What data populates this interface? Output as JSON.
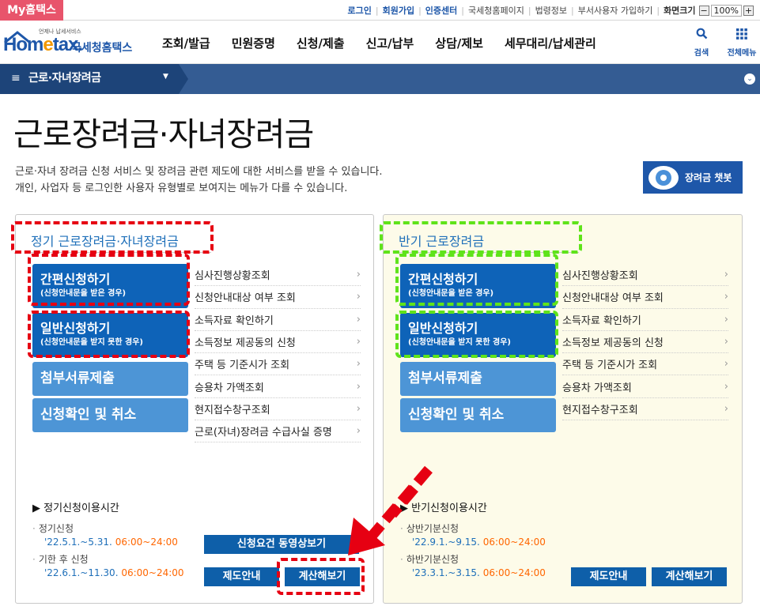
{
  "topbar": {
    "my_tab": "My홈택스",
    "links": [
      {
        "label": "로그인",
        "emphasis": true
      },
      {
        "label": "회원가입",
        "emphasis": true
      },
      {
        "label": "인증센터",
        "emphasis": true
      },
      {
        "label": "국세청홈페이지",
        "emphasis": false
      },
      {
        "label": "법령정보",
        "emphasis": false
      },
      {
        "label": "부서사용자 가입하기",
        "emphasis": false
      }
    ],
    "zoom_label": "화면크기",
    "zoom_minus": "−",
    "zoom_value": "100%",
    "zoom_plus": "+"
  },
  "header": {
    "logo_small": "언제나 납세서비스",
    "logo_text_a": "Hom",
    "logo_text_e": "e",
    "logo_text_b": "tax.",
    "logo_kr": "국세청홈택스",
    "gnb": [
      "조회/발급",
      "민원증명",
      "신청/제출",
      "신고/납부",
      "상담/제보",
      "세무대리/납세관리"
    ],
    "search_label": "검색",
    "search_icon": "search-icon",
    "all_menu_label": "전체메뉴",
    "all_menu_icon": "grid-icon"
  },
  "navbar": {
    "menu_icon": "≡",
    "title": "근로·자녀장려금",
    "caret": "▼",
    "expand": "⌄"
  },
  "page": {
    "title": "근로장려금·자녀장려금",
    "desc1": "근로·자녀 장려금 신청 서비스 및 장려금 관련 제도에 대한 서비스를 받을 수 있습니다.",
    "desc2": "개인, 사업자 등 로그인한 사용자 유형별로 보여지는 메뉴가 다를 수 있습니다.",
    "chatbot_label": "장려금 챗봇"
  },
  "left_panel": {
    "title": "정기 근로장려금·자녀장려금",
    "btn_easy": "간편신청하기",
    "btn_easy_sub": "(신청안내문을 받은 경우)",
    "btn_general": "일반신청하기",
    "btn_general_sub": "(신청안내문을 받지 못한 경우)",
    "btn_attach": "첨부서류제출",
    "btn_confirm": "신청확인 및 취소",
    "links": [
      "심사진행상황조회",
      "신청안내대상 여부 조회",
      "소득자료 확인하기",
      "소득정보 제공동의 신청",
      "주택 등 기준시가 조회",
      "승용차 가액조회",
      "현지접수창구조회",
      "근로(자녀)장려금 수급사실 증명"
    ],
    "time_title": "정기신청이용시간",
    "time_items": [
      {
        "label": "정기신청",
        "date": "'22.5.1.~5.31.",
        "time": "06:00~24:00"
      },
      {
        "label": "기한 후 신청",
        "date": "'22.6.1.~11.30.",
        "time": "06:00~24:00"
      }
    ],
    "btn_video": "신청요건 동영상보기",
    "btn_guide": "제도안내",
    "btn_calc": "계산해보기"
  },
  "right_panel": {
    "title": "반기 근로장려금",
    "btn_easy": "간편신청하기",
    "btn_easy_sub": "(신청안내문을 받은 경우)",
    "btn_general": "일반신청하기",
    "btn_general_sub": "(신청안내문을 받지 못한 경우)",
    "btn_attach": "첨부서류제출",
    "btn_confirm": "신청확인 및 취소",
    "links": [
      "심사진행상황조회",
      "신청안내대상 여부 조회",
      "소득자료 확인하기",
      "소득정보 제공동의 신청",
      "주택 등 기준시가 조회",
      "승용차 가액조회",
      "현지접수창구조회"
    ],
    "time_title": "반기신청이용시간",
    "time_items": [
      {
        "label": "상반기분신청",
        "date": "'22.9.1.~9.15.",
        "time": "06:00~24:00"
      },
      {
        "label": "하반기분신청",
        "date": "'23.3.1.~3.15.",
        "time": "06:00~24:00"
      }
    ],
    "btn_guide": "제도안내",
    "btn_calc": "계산해보기"
  },
  "colors": {
    "brand_blue": "#1e57a9",
    "nav_bar": "#345c93",
    "btn_dark": "#0e63b8",
    "btn_light": "#4d95d6",
    "time_orange": "#ff6600",
    "annotation_red": "#e60012",
    "annotation_green": "#5fe31a"
  }
}
